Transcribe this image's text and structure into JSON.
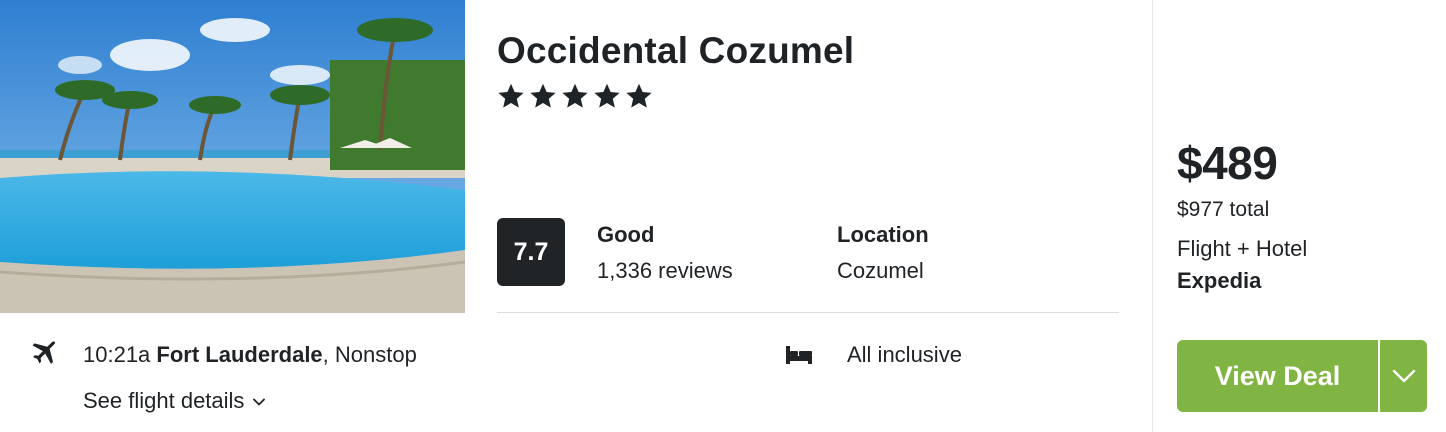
{
  "hotel": {
    "name": "Occidental Cozumel",
    "star_rating": 5,
    "image_alt": "Resort pool with palm trees"
  },
  "rating": {
    "score": "7.7",
    "label": "Good",
    "reviews": "1,336 reviews"
  },
  "location": {
    "label": "Location",
    "value": "Cozumel"
  },
  "flight": {
    "time": "10:21a",
    "origin": "Fort Lauderdale",
    "stops": ", Nonstop",
    "details_link": "See flight details"
  },
  "amenity": {
    "label": "All inclusive",
    "icon": "bed-icon"
  },
  "pricing": {
    "price": "$489",
    "total": "$977 total",
    "package": "Flight + Hotel",
    "provider": "Expedia"
  },
  "cta": {
    "label": "View Deal",
    "color": "#80b543"
  },
  "colors": {
    "score_badge": "#212427",
    "text": "#1f2326"
  }
}
